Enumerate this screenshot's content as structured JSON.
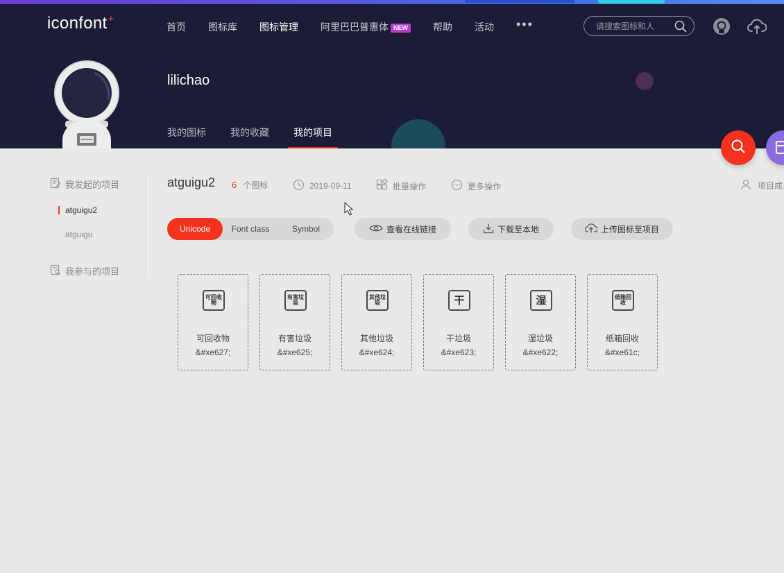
{
  "app": {
    "logo_text": "iconfont",
    "logo_plus": "+"
  },
  "nav": {
    "items": [
      {
        "label": "首页"
      },
      {
        "label": "图标库"
      },
      {
        "label": "图标管理",
        "active": true
      },
      {
        "label": "阿里巴巴普惠体",
        "badge": "NEW"
      },
      {
        "label": "帮助"
      },
      {
        "label": "活动"
      }
    ],
    "more": "•••"
  },
  "search": {
    "placeholder": "请搜索图标和人"
  },
  "profile": {
    "username": "lilichao",
    "tabs": [
      {
        "label": "我的图标"
      },
      {
        "label": "我的收藏"
      },
      {
        "label": "我的项目",
        "active": true
      }
    ]
  },
  "sidebar": {
    "initiated_label": "我发起的项目",
    "projects": [
      {
        "label": "atguigu2",
        "active": true
      },
      {
        "label": "atguigu"
      }
    ],
    "joined_label": "我参与的项目"
  },
  "project": {
    "title": "atguigu2",
    "icon_count": "6",
    "icon_count_unit": "个图标",
    "date": "2019-09-11",
    "batch_label": "批量操作",
    "more_label": "更多操作",
    "members_label": "项目成员"
  },
  "formats": {
    "items": [
      {
        "label": "Unicode",
        "active": true
      },
      {
        "label": "Font class"
      },
      {
        "label": "Symbol"
      }
    ]
  },
  "actions": {
    "view_link": "查看在线链接",
    "download": "下载至本地",
    "upload": "上传图标至项目"
  },
  "icons": [
    {
      "glyph": "可回收物",
      "name": "可回收物",
      "code": "&#xe627;"
    },
    {
      "glyph": "有害垃圾",
      "name": "有害垃圾",
      "code": "&#xe625;"
    },
    {
      "glyph": "其他垃圾",
      "name": "其他垃圾",
      "code": "&#xe624;"
    },
    {
      "glyph": "干",
      "name": "干垃圾",
      "code": "&#xe623;"
    },
    {
      "glyph": "湿",
      "name": "湿垃圾",
      "code": "&#xe622;"
    },
    {
      "glyph": "纸箱回收",
      "name": "纸箱回收",
      "code": "&#xe61c;"
    }
  ],
  "colors": {
    "header_bg": "#1b1c35",
    "accent": "#f5311f",
    "page_bg": "#e9e9e7"
  }
}
